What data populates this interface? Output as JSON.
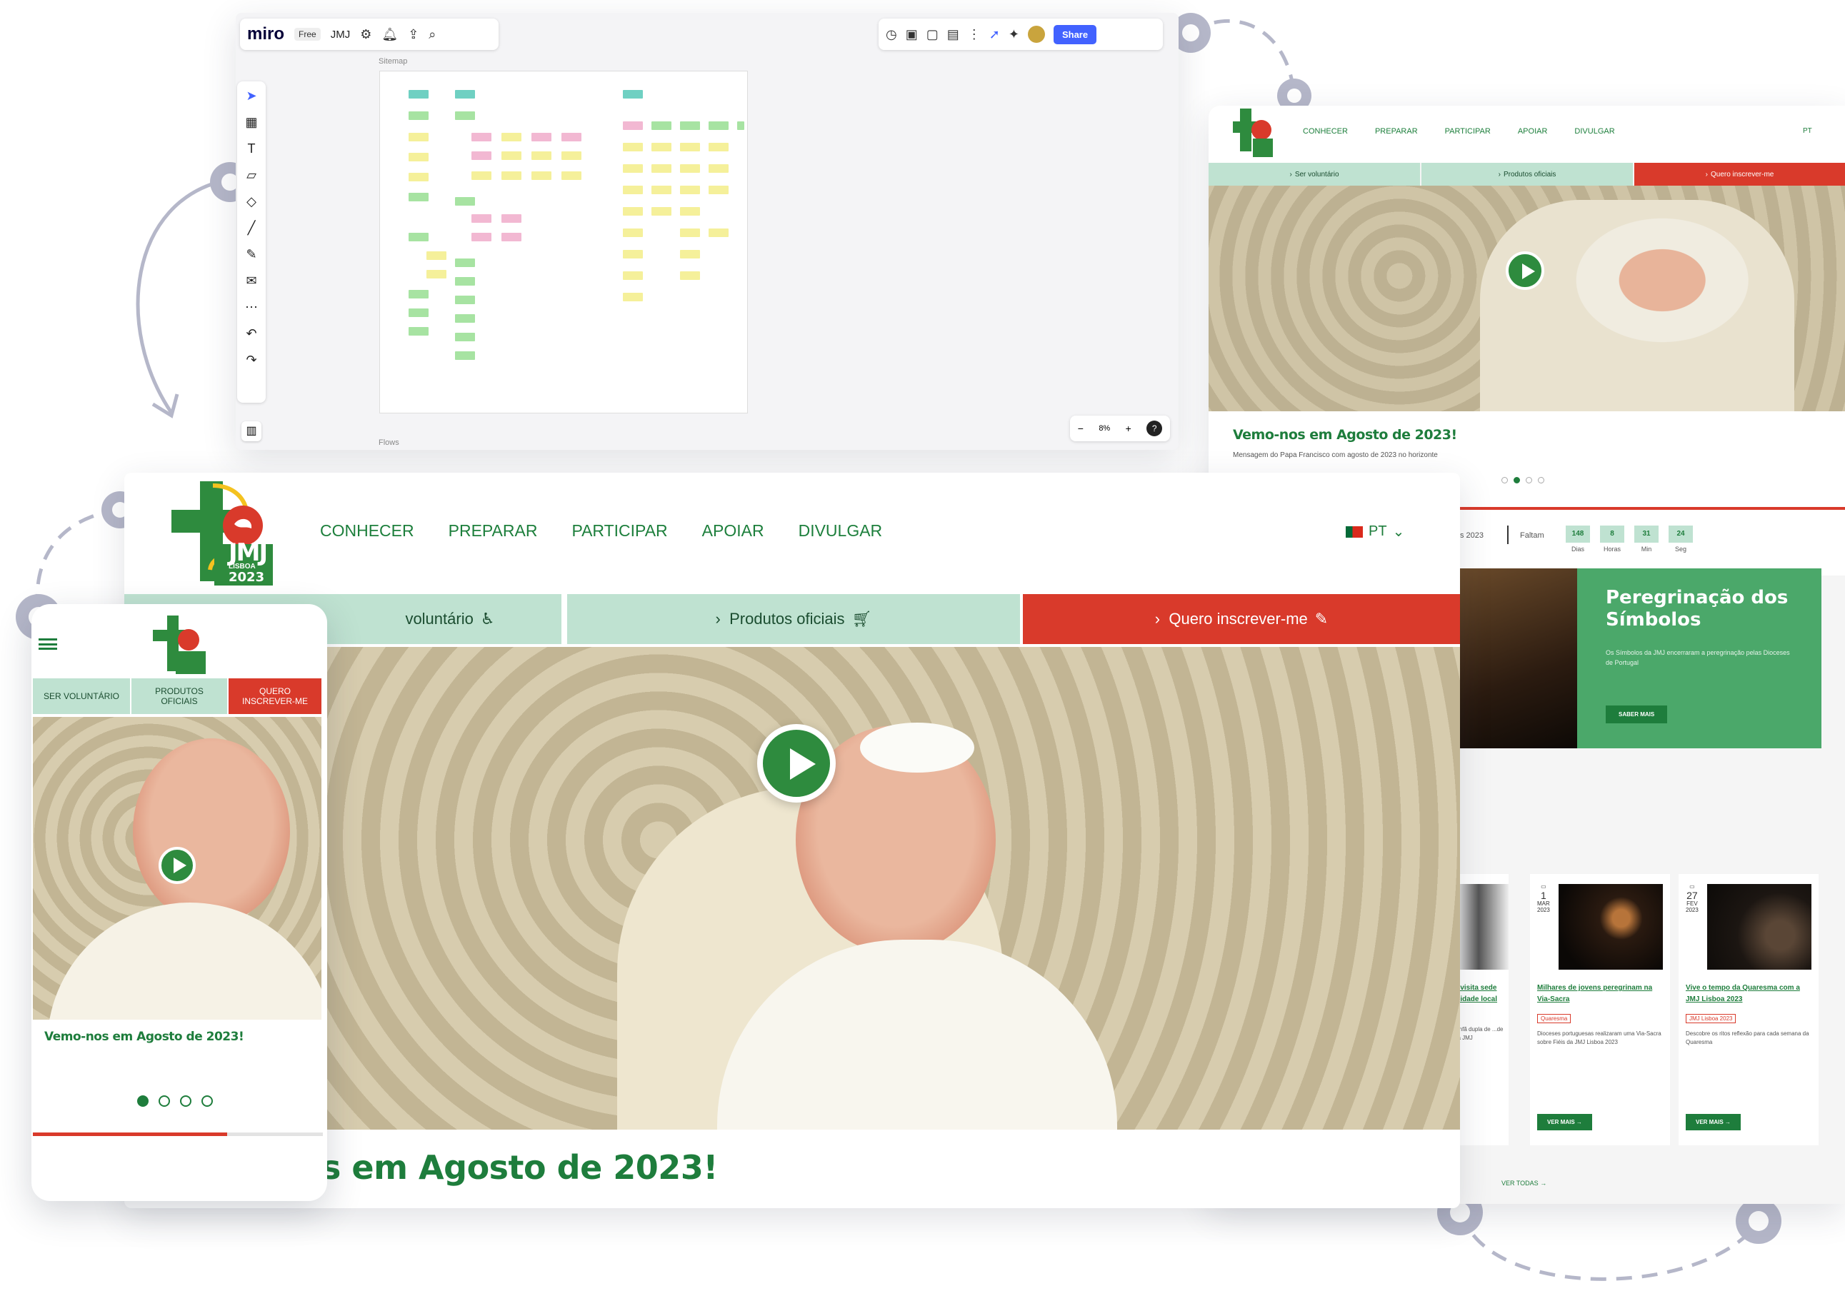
{
  "miro": {
    "logo": "miro",
    "plan_badge": "Free",
    "board_name": "JMJ",
    "share_label": "Share",
    "frame_label_top": "Sitemap",
    "frame_label_bottom": "Flows",
    "zoom": "8%"
  },
  "site": {
    "logo": {
      "line1": "JMJ",
      "line2": "LISBOA",
      "line3": "2023"
    },
    "nav": [
      "CONHECER",
      "PREPARAR",
      "PARTICIPAR",
      "APOIAR",
      "DIVULGAR"
    ],
    "language": "PT",
    "actions": {
      "volunteer": "Ser voluntário",
      "volunteer_partial": "voluntário",
      "products": "Produtos oficiais",
      "register": "Quero inscrever-me"
    },
    "hero": {
      "title": "Vemo-nos em Agosto de 2023!",
      "title_partial": "s em Agosto de 2023!",
      "subtitle": "Mensagem do Papa Francisco com agosto de 2023 no horizonte"
    },
    "countdown": {
      "lead": "s 2023",
      "prefix": "Faltam",
      "units": [
        {
          "value": "148",
          "label": "Dias"
        },
        {
          "value": "8",
          "label": "Horas"
        },
        {
          "value": "31",
          "label": "Min"
        },
        {
          "value": "24",
          "label": "Seg"
        }
      ]
    },
    "feature": {
      "title": "Peregrinação dos Símbolos",
      "text": "Os Símbolos da JMJ encerraram a peregrinação pelas Dioceses de Portugal",
      "button": "SABER MAIS"
    },
    "news": [
      {
        "date_day": "",
        "date_month": "",
        "title": "...visita sede ...idade local",
        "tag": "",
        "excerpt": "...nfã dupla de ...de da JMJ",
        "button": ""
      },
      {
        "date_day": "1",
        "date_month": "MAR",
        "date_year": "2023",
        "title": "Milhares de jovens peregrinam na Via-Sacra",
        "tag": "Quaresma",
        "excerpt": "Dioceses portuguesas realizaram uma Via-Sacra sobre Fiéis da JMJ Lisboa 2023",
        "button": "VER MAIS"
      },
      {
        "date_day": "27",
        "date_month": "FEV",
        "date_year": "2023",
        "title": "Vive o tempo da Quaresma com a JMJ Lisboa 2023",
        "tag": "JMJ Lisboa 2023",
        "excerpt": "Descobre os ritos reflexão para cada semana da Quaresma",
        "button": "VER MAIS"
      }
    ],
    "see_all": "VER TODAS"
  },
  "mobile": {
    "actions": [
      "SER VOLUNTÁRIO",
      "PRODUTOS OFICIAIS",
      "QUERO INSCREVER-ME"
    ]
  },
  "colors": {
    "brand_green": "#1e7d3c",
    "accent_red": "#d93a2b",
    "mint": "#bfe2d1",
    "connector": "#b5b7c9"
  }
}
